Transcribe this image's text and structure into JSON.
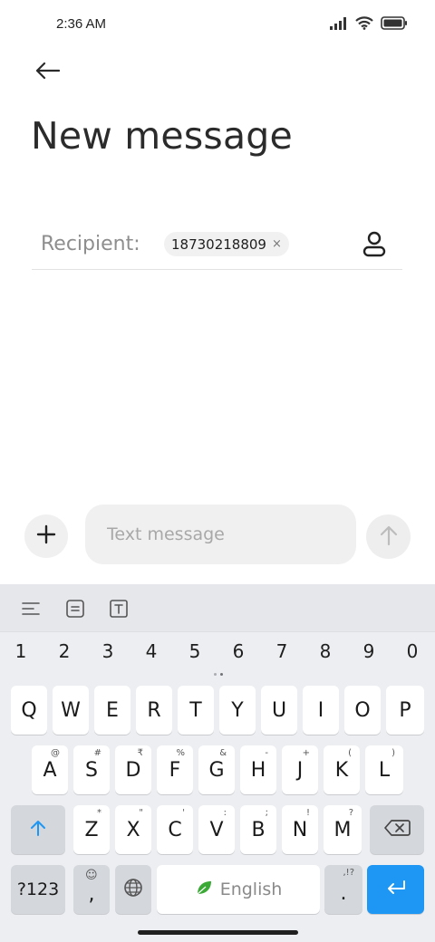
{
  "status_bar": {
    "time": "2:36 AM",
    "icons": [
      "signal-icon",
      "wifi-icon",
      "battery-icon"
    ]
  },
  "header": {
    "back_icon": "arrow-left-icon",
    "title": "New message"
  },
  "recipient": {
    "label": "Recipient:",
    "chips": [
      {
        "text": "18730218809",
        "remove_glyph": "×"
      }
    ],
    "contact_icon": "person-icon"
  },
  "compose": {
    "add_icon": "plus-icon",
    "placeholder": "Text message",
    "value": "",
    "send_icon": "arrow-up-icon"
  },
  "keyboard": {
    "toolbar": [
      "menu-icon",
      "clipboard-icon",
      "text-format-icon"
    ],
    "numbers": [
      "1",
      "2",
      "3",
      "4",
      "5",
      "6",
      "7",
      "8",
      "9",
      "0"
    ],
    "row1": [
      {
        "k": "Q",
        "h": ""
      },
      {
        "k": "W",
        "h": ""
      },
      {
        "k": "E",
        "h": ""
      },
      {
        "k": "R",
        "h": ""
      },
      {
        "k": "T",
        "h": ""
      },
      {
        "k": "Y",
        "h": ""
      },
      {
        "k": "U",
        "h": ""
      },
      {
        "k": "I",
        "h": ""
      },
      {
        "k": "O",
        "h": ""
      },
      {
        "k": "P",
        "h": ""
      }
    ],
    "row2": [
      {
        "k": "A",
        "h": "@"
      },
      {
        "k": "S",
        "h": "#"
      },
      {
        "k": "D",
        "h": "₹"
      },
      {
        "k": "F",
        "h": "%"
      },
      {
        "k": "G",
        "h": "&"
      },
      {
        "k": "H",
        "h": "-"
      },
      {
        "k": "J",
        "h": "+"
      },
      {
        "k": "K",
        "h": "("
      },
      {
        "k": "L",
        "h": ")"
      }
    ],
    "row3": [
      {
        "k": "Z",
        "h": "*"
      },
      {
        "k": "X",
        "h": "\""
      },
      {
        "k": "C",
        "h": "'"
      },
      {
        "k": "V",
        "h": ":"
      },
      {
        "k": "B",
        "h": ";"
      },
      {
        "k": "N",
        "h": "!"
      },
      {
        "k": "M",
        "h": "?"
      }
    ],
    "shift_icon": "shift-arrow-icon",
    "backspace_icon": "backspace-icon",
    "symbols_label": "?123",
    "comma_label": ",",
    "comma_hint": "☺",
    "globe_icon": "globe-icon",
    "space_label": "English",
    "period_label": ".",
    "period_hint": ",!?",
    "enter_icon": "enter-icon",
    "accent_color": "#1e96f3"
  }
}
